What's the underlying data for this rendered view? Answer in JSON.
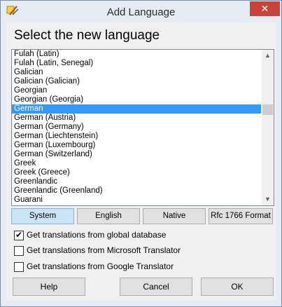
{
  "window": {
    "title": "Add Language",
    "close_label": "✕"
  },
  "heading": "Select the new language",
  "languages": [
    "Fulah (Latin)",
    "Fulah (Latin, Senegal)",
    "Galician",
    "Galician (Galician)",
    "Georgian",
    "Georgian (Georgia)",
    "German",
    "German (Austria)",
    "German (Germany)",
    "German (Liechtenstein)",
    "German (Luxembourg)",
    "German (Switzerland)",
    "Greek",
    "Greek (Greece)",
    "Greenlandic",
    "Greenlandic (Greenland)",
    "Guarani"
  ],
  "selected_language": "German",
  "scroll": {
    "up_arrow": "▲",
    "down_arrow": "▼"
  },
  "name_tabs": [
    {
      "label": "System",
      "active": true
    },
    {
      "label": "English",
      "active": false
    },
    {
      "label": "Native",
      "active": false
    },
    {
      "label": "Rfc 1766 Format",
      "active": false
    }
  ],
  "options": [
    {
      "label": "Get translations from global database",
      "checked": true
    },
    {
      "label": "Get translations from Microsoft Translator",
      "checked": false
    },
    {
      "label": "Get translations from Google Translator",
      "checked": false
    }
  ],
  "buttons": {
    "help": "Help",
    "cancel": "Cancel",
    "ok": "OK"
  },
  "colors": {
    "selection": "#3399ff",
    "close_button": "#c8443a",
    "active_tab": "#cce4f7"
  }
}
